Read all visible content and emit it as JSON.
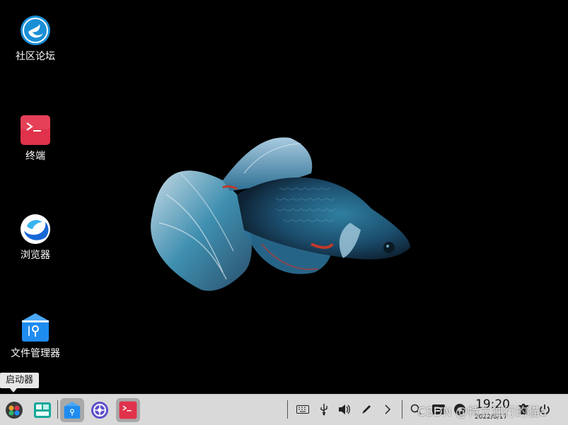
{
  "desktop": {
    "icons": [
      {
        "label": "社区论坛",
        "icon": "deepin-logo-icon"
      },
      {
        "label": "终端",
        "icon": "terminal-icon"
      },
      {
        "label": "浏览器",
        "icon": "browser-icon"
      },
      {
        "label": "文件管理器",
        "icon": "file-manager-icon"
      }
    ]
  },
  "tooltip": {
    "text": "启动器"
  },
  "taskbar": {
    "apps": [
      {
        "name": "launcher",
        "icon": "launcher-icon"
      },
      {
        "name": "multitasking",
        "icon": "multitask-view-icon"
      },
      {
        "name": "file-manager",
        "icon": "file-manager-icon",
        "active": true
      },
      {
        "name": "control-center",
        "icon": "settings-icon"
      },
      {
        "name": "terminal",
        "icon": "terminal-icon",
        "active": true
      }
    ],
    "tray": [
      "keyboard-icon",
      "usb-icon",
      "volume-icon",
      "pen-icon",
      "chevron-right-icon",
      "search-icon",
      "notification-icon",
      "power-icon",
      "trash-icon",
      "shutdown-icon"
    ],
    "clock": {
      "time": "19:20",
      "date": "2022/6/17"
    }
  },
  "watermark": "CSDN @特立独行的猫a",
  "colors": {
    "taskbar": "#d9d9d9",
    "desktop": "#000000",
    "terminal_red": "#e0324b",
    "file_blue": "#1f8cf0"
  }
}
